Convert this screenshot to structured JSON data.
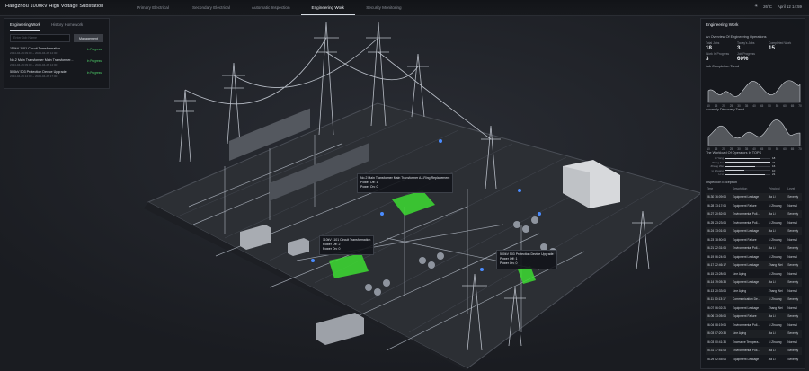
{
  "app": {
    "title": "Hangzhou 1000kV High Voltage Substation"
  },
  "nav": {
    "tabs": [
      "Primary Electrical",
      "Secondary Electrical",
      "Automatic Inspection",
      "Engineering Work",
      "Security Monitoring"
    ],
    "active": 3
  },
  "status": {
    "weather": "26°C",
    "date": "April 12 14:59"
  },
  "left_panel": {
    "tabs": [
      "Engineering Work",
      "History Homework"
    ],
    "search_placeholder": "Enter Job Name",
    "management_button": "Management",
    "items": [
      {
        "name": "110kV 1101 Circuit Transformation",
        "time": "2024-04-26 09:00 ~ 2024-04-26 14:00",
        "status": "In Progress"
      },
      {
        "name": "No.2 Main Transformer Main Transformer...",
        "time": "2024-04-26 09:00 ~ 2024-04-26 14:00",
        "status": "In Progress"
      },
      {
        "name": "500kV 503 Protection Device Upgrade",
        "time": "2024-04-26 14:00 ~ 2024-04-26 17:00",
        "status": "In Progress"
      }
    ]
  },
  "right_panel": {
    "title": "Engineering Work",
    "overview_title": "An Overview Of Engineering Operations",
    "stats": [
      {
        "label": "Total Jobs",
        "value": "18"
      },
      {
        "label": "Today's Jobs",
        "value": "3"
      },
      {
        "label": "Completed Work",
        "value": "15"
      },
      {
        "label": "Work In Progress",
        "value": "3"
      },
      {
        "label": "Job Progress",
        "value": "60%"
      }
    ],
    "trend_title": "Job Completion Trend",
    "trend_ticks": [
      "10",
      "15",
      "20",
      "25",
      "30",
      "35",
      "40",
      "45",
      "50",
      "55",
      "60",
      "65",
      "70"
    ],
    "anomaly_title": "Anomaly Discovery Trend",
    "anomaly_ticks": [
      "10",
      "15",
      "20",
      "25",
      "30",
      "35",
      "40",
      "45",
      "50",
      "55",
      "60",
      "65",
      "70"
    ],
    "workload_title": "The Workload Of Operators In TOPS",
    "workload": [
      {
        "name": "Li Yang",
        "value": 18
      },
      {
        "name": "Wang Fei",
        "value": 24
      },
      {
        "name": "Zhang Wei",
        "value": 16
      },
      {
        "name": "Li Zhuang",
        "value": 10
      },
      {
        "name": "Li Li",
        "value": 21
      }
    ],
    "exception_title": "Inspection Exception",
    "exception_headers": [
      "Time",
      "Description",
      "Principal",
      "Level"
    ],
    "exceptions": [
      [
        "06.30 16:09:06",
        "Equipment Leakage",
        "Jia Li",
        "Severity"
      ],
      [
        "06.28 13:17:06",
        "Equipment Failure",
        "Li Zhuang",
        "Normal"
      ],
      [
        "06.27 20:52:06",
        "Environmental Poll...",
        "Jia Li",
        "Severity"
      ],
      [
        "06.25 23:23:06",
        "Environmental Poll...",
        "Li Zhuang",
        "Normal"
      ],
      [
        "06.24 13:01:06",
        "Equipment Leakage",
        "Jia Li",
        "Severity"
      ],
      [
        "06.23 18:50:06",
        "Equipment Failure",
        "Li Zhuang",
        "Normal"
      ],
      [
        "06.21 22:31:06",
        "Environmental Poll...",
        "Jia Li",
        "Severity"
      ],
      [
        "06.19 06:24:06",
        "Equipment Leakage",
        "Li Zhuang",
        "Normal"
      ],
      [
        "06.17 22:46:17",
        "Equipment Leakage",
        "Zhang Wei",
        "Severity"
      ],
      [
        "06.15 23:28:06",
        "Line Aging",
        "Li Zhuang",
        "Normal"
      ],
      [
        "06.14 19:05:35",
        "Equipment Leakage",
        "Jia Li",
        "Severity"
      ],
      [
        "06.13 20:33:06",
        "Line Aging",
        "Zhang Wei",
        "Normal"
      ],
      [
        "06.11 00:13:17",
        "Communication De...",
        "Li Zhuang",
        "Severity"
      ],
      [
        "06.07 06:02:21",
        "Equipment Leakage",
        "Zhang Wei",
        "Normal"
      ],
      [
        "06.06 13:05:06",
        "Equipment Failure",
        "Jia Li",
        "Severity"
      ],
      [
        "06.04 08:19:06",
        "Environmental Poll...",
        "Li Zhuang",
        "Normal"
      ],
      [
        "06.03 07:20:35",
        "Line Aging",
        "Jia Li",
        "Severity"
      ],
      [
        "06.03 00:41:36",
        "Excessive Tempera...",
        "Li Zhuang",
        "Normal"
      ],
      [
        "05.31 17:51:08",
        "Environmental Poll...",
        "Jia Li",
        "Severity"
      ],
      [
        "05.29 02:45:06",
        "Equipment Leakage",
        "Jia Li",
        "Severity"
      ]
    ]
  },
  "tooltips": [
    {
      "title": "No.2 Main Transformer Main Transformer A-l-Ring Replacement",
      "l1": "Power Off: 1",
      "l2": "Power On: 0"
    },
    {
      "title": "110kV 1101 Circuit Transformation",
      "l1": "Power Off: 2",
      "l2": "Power On: 0"
    },
    {
      "title": "500kV 503 Protection Device Upgrade",
      "l1": "Power Off: 1",
      "l2": "Power On: 0"
    }
  ],
  "colors": {
    "accent": "#4fd16b",
    "highlight": "#3ddc33",
    "background": "#1b1d22"
  }
}
